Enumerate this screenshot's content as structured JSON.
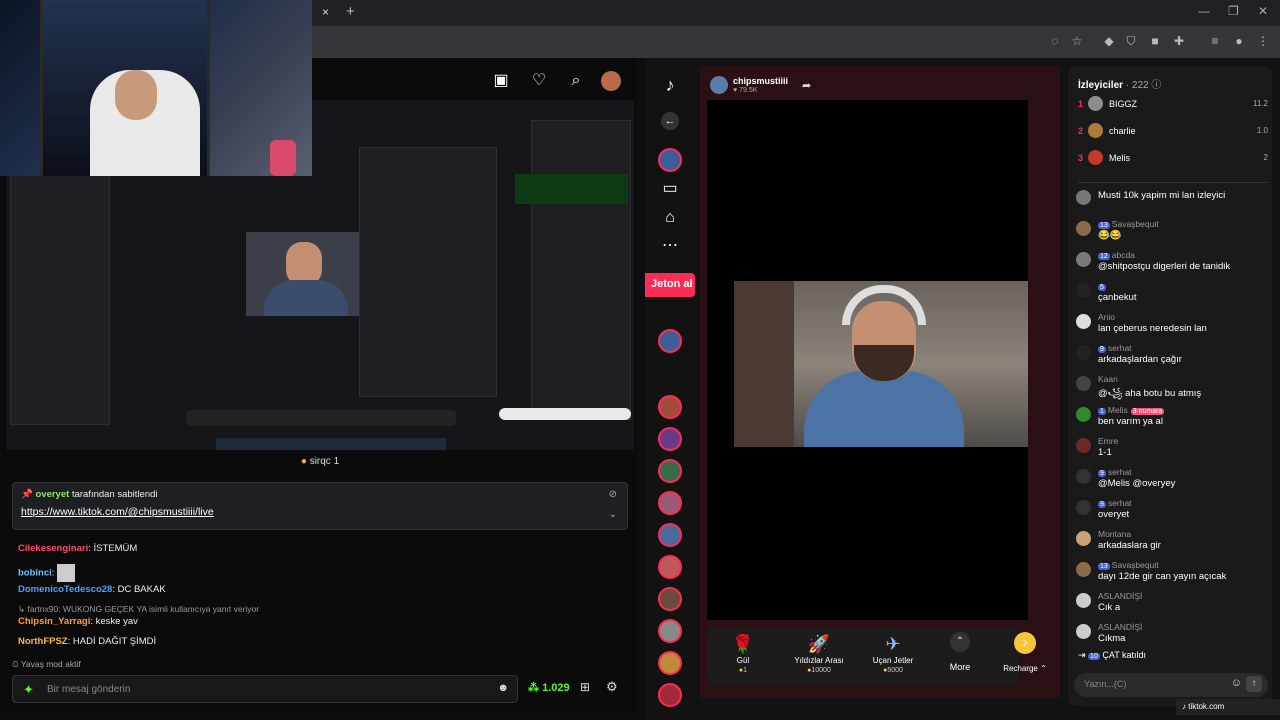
{
  "browser": {
    "tab_close": "×",
    "new_tab": "+",
    "window_controls": [
      "—",
      "❐",
      "✕"
    ]
  },
  "kick": {
    "viewers": "sirqc 1",
    "pinned": {
      "by_user": "overyet",
      "by_suffix": "tarafından sabitlendi",
      "link": "https://www.tiktok.com/@chipsmustiiii/live"
    },
    "messages": [
      {
        "user": "Cilekesenginari",
        "text": ": İSTEMÜM",
        "color": "#ff4d6d"
      },
      {
        "user": "bobinci",
        "text": ":",
        "color": "#6ec1ff"
      },
      {
        "user": "DomenicoTedesco28",
        "text": ": DC BAKAK",
        "color": "#4aa3ff"
      },
      {
        "user": "Chipsin_Yarragi",
        "text": ": keske yav",
        "color": "#ff9b3d"
      },
      {
        "user": "NorthFPSZ",
        "text": ": HADİ DAĞIT ŞİMDİ",
        "color": "#ffb74d"
      }
    ],
    "reply_note": "fartnx90: WUKONG GEÇEK YA isimli kullanıcıya yanıt veriyor",
    "slow_mode": "Yavaş mod aktif",
    "input_placeholder": "Bir mesaj gönderin",
    "points": "1.029"
  },
  "tiktok": {
    "host": {
      "name": "chipsmustiiii",
      "likes": "♥ 79.5K"
    },
    "jeton": "Jeton al",
    "gifts": [
      {
        "name": "Gül",
        "price": "1",
        "icon": "🌹"
      },
      {
        "name": "Yıldızlar Arası",
        "price": "10000",
        "icon": "🚀"
      },
      {
        "name": "Uçan Jetler",
        "price": "5000",
        "icon": "✈"
      }
    ],
    "more": "More",
    "recharge": "Recharge",
    "viewers_title": "İzleyiciler",
    "viewers_count": "· 222",
    "top": [
      {
        "rank": "1",
        "name": "BIGGZ",
        "score": "11.2",
        "color": "#8d8d8d"
      },
      {
        "rank": "2",
        "name": "charlie",
        "score": "1.0",
        "color": "#b07a3a"
      },
      {
        "rank": "3",
        "name": "Melis",
        "score": "2",
        "color": "#c0392b"
      }
    ],
    "comments": [
      {
        "user": "",
        "level": "",
        "badge": "",
        "text": "Musti 10k yapim mi lan izleyici"
      },
      {
        "user": "Savaşbequit",
        "level": "13",
        "badge": "",
        "text": "😂😂"
      },
      {
        "user": "abcda",
        "level": "12",
        "badge": "",
        "text": "@shitpostçu digerleri de tanidik"
      },
      {
        "user": "",
        "level": "5",
        "badge": "",
        "text": "çanbekut"
      },
      {
        "user": "Anio",
        "level": "",
        "badge": "",
        "text": "lan çeberus neredesin lan"
      },
      {
        "user": "serhat",
        "level": "9",
        "badge": "",
        "text": "arkadaşlardan çağır"
      },
      {
        "user": "Kaan",
        "level": "",
        "badge": "",
        "text": "@꧁ aha botu bu atmış"
      },
      {
        "user": "Melis",
        "level": "1",
        "badge": "3 numara",
        "text": "ben varım ya al"
      },
      {
        "user": "Emre",
        "level": "",
        "badge": "",
        "text": "1-1"
      },
      {
        "user": "serhat",
        "level": "9",
        "badge": "",
        "text": "@Melis @overyey"
      },
      {
        "user": "serhat",
        "level": "9",
        "badge": "",
        "text": "overyet"
      },
      {
        "user": "Montana",
        "level": "",
        "badge": "",
        "text": "arkadaslara gir"
      },
      {
        "user": "Savaşbequit",
        "level": "13",
        "badge": "",
        "text": "dayı 12de gir can yayın açıcak"
      },
      {
        "user": "ASLANDİŞİ",
        "level": "",
        "badge": "",
        "text": "Cık a"
      },
      {
        "user": "ASLANDİŞİ",
        "level": "",
        "badge": "",
        "text": "Cıkma"
      }
    ],
    "joined": {
      "level": "10",
      "user": "ÇAT",
      "text": "katıldı"
    },
    "input_placeholder": "Yazın...(C)",
    "footer": "tiktok.com"
  }
}
